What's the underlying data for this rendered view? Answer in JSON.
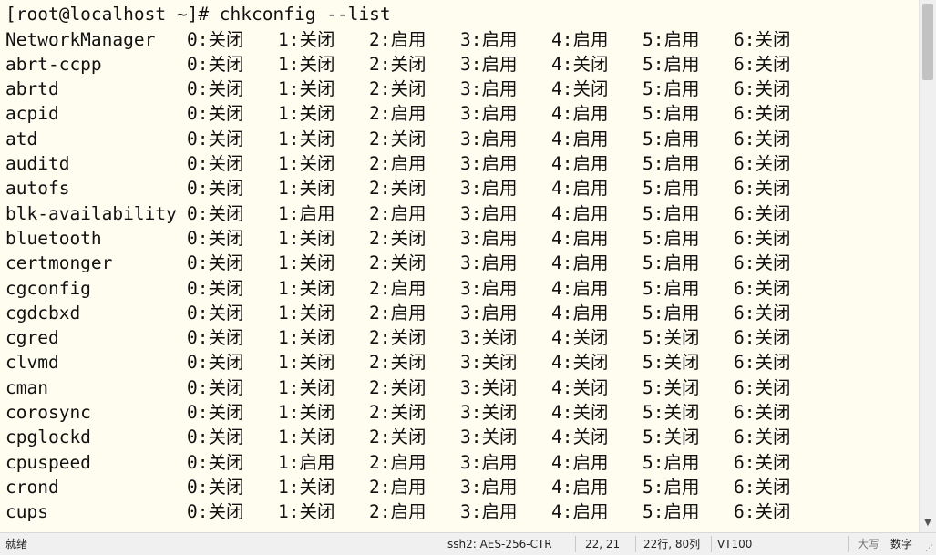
{
  "terminal": {
    "prompt_line": "[root@localhost ~]# chkconfig --list",
    "services": [
      {
        "name": "NetworkManager",
        "levels": [
          "0:关闭",
          "1:关闭",
          "2:启用",
          "3:启用",
          "4:启用",
          "5:启用",
          "6:关闭"
        ]
      },
      {
        "name": "abrt-ccpp",
        "levels": [
          "0:关闭",
          "1:关闭",
          "2:关闭",
          "3:启用",
          "4:关闭",
          "5:启用",
          "6:关闭"
        ]
      },
      {
        "name": "abrtd",
        "levels": [
          "0:关闭",
          "1:关闭",
          "2:关闭",
          "3:启用",
          "4:关闭",
          "5:启用",
          "6:关闭"
        ]
      },
      {
        "name": "acpid",
        "levels": [
          "0:关闭",
          "1:关闭",
          "2:启用",
          "3:启用",
          "4:启用",
          "5:启用",
          "6:关闭"
        ]
      },
      {
        "name": "atd",
        "levels": [
          "0:关闭",
          "1:关闭",
          "2:关闭",
          "3:启用",
          "4:启用",
          "5:启用",
          "6:关闭"
        ]
      },
      {
        "name": "auditd",
        "levels": [
          "0:关闭",
          "1:关闭",
          "2:启用",
          "3:启用",
          "4:启用",
          "5:启用",
          "6:关闭"
        ]
      },
      {
        "name": "autofs",
        "levels": [
          "0:关闭",
          "1:关闭",
          "2:关闭",
          "3:启用",
          "4:启用",
          "5:启用",
          "6:关闭"
        ]
      },
      {
        "name": "blk-availability",
        "levels": [
          "0:关闭",
          "1:启用",
          "2:启用",
          "3:启用",
          "4:启用",
          "5:启用",
          "6:关闭"
        ]
      },
      {
        "name": "bluetooth",
        "levels": [
          "0:关闭",
          "1:关闭",
          "2:关闭",
          "3:启用",
          "4:启用",
          "5:启用",
          "6:关闭"
        ]
      },
      {
        "name": "certmonger",
        "levels": [
          "0:关闭",
          "1:关闭",
          "2:关闭",
          "3:启用",
          "4:启用",
          "5:启用",
          "6:关闭"
        ]
      },
      {
        "name": "cgconfig",
        "levels": [
          "0:关闭",
          "1:关闭",
          "2:启用",
          "3:启用",
          "4:启用",
          "5:启用",
          "6:关闭"
        ]
      },
      {
        "name": "cgdcbxd",
        "levels": [
          "0:关闭",
          "1:关闭",
          "2:启用",
          "3:启用",
          "4:启用",
          "5:启用",
          "6:关闭"
        ]
      },
      {
        "name": "cgred",
        "levels": [
          "0:关闭",
          "1:关闭",
          "2:关闭",
          "3:关闭",
          "4:关闭",
          "5:关闭",
          "6:关闭"
        ]
      },
      {
        "name": "clvmd",
        "levels": [
          "0:关闭",
          "1:关闭",
          "2:关闭",
          "3:关闭",
          "4:关闭",
          "5:关闭",
          "6:关闭"
        ]
      },
      {
        "name": "cman",
        "levels": [
          "0:关闭",
          "1:关闭",
          "2:关闭",
          "3:关闭",
          "4:关闭",
          "5:关闭",
          "6:关闭"
        ]
      },
      {
        "name": "corosync",
        "levels": [
          "0:关闭",
          "1:关闭",
          "2:关闭",
          "3:关闭",
          "4:关闭",
          "5:关闭",
          "6:关闭"
        ]
      },
      {
        "name": "cpglockd",
        "levels": [
          "0:关闭",
          "1:关闭",
          "2:关闭",
          "3:关闭",
          "4:关闭",
          "5:关闭",
          "6:关闭"
        ]
      },
      {
        "name": "cpuspeed",
        "levels": [
          "0:关闭",
          "1:启用",
          "2:启用",
          "3:启用",
          "4:启用",
          "5:启用",
          "6:关闭"
        ]
      },
      {
        "name": "crond",
        "levels": [
          "0:关闭",
          "1:关闭",
          "2:启用",
          "3:启用",
          "4:启用",
          "5:启用",
          "6:关闭"
        ]
      },
      {
        "name": "cups",
        "levels": [
          "0:关闭",
          "1:关闭",
          "2:启用",
          "3:启用",
          "4:启用",
          "5:启用",
          "6:关闭"
        ]
      }
    ]
  },
  "statusbar": {
    "status": "就绪",
    "connection": "ssh2: AES-256-CTR",
    "cursor": "22,  21",
    "position": "22行, 80列",
    "terminal_type": "VT100",
    "caps": "大写",
    "numlock": "数字"
  }
}
